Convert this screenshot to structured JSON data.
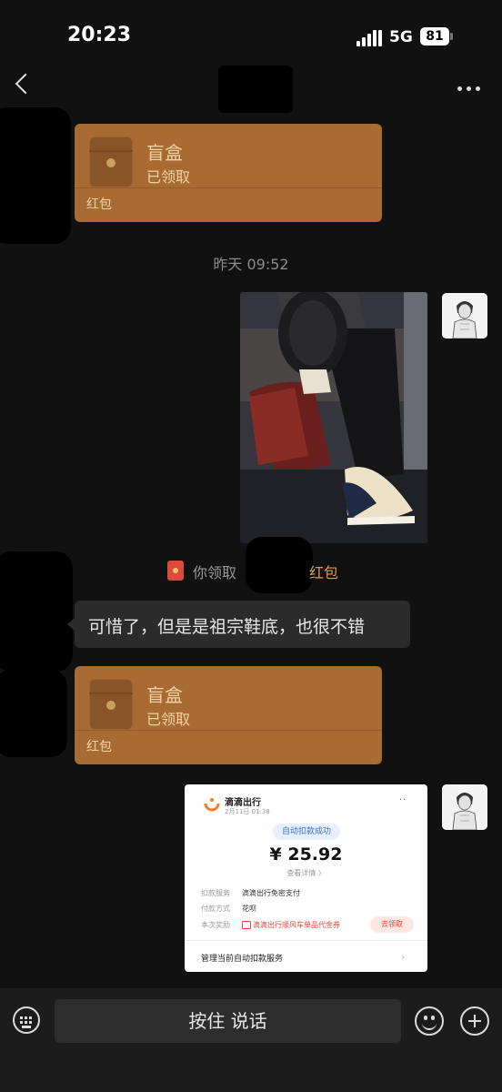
{
  "status_bar": {
    "time": "20:23",
    "network": "5G",
    "battery": "81"
  },
  "nav": {
    "back_icon": "chevron-left-icon",
    "more_icon": "more-dots-icon"
  },
  "messages": {
    "packet_1": {
      "title": "盲盒",
      "status": "已领取",
      "label": "红包"
    },
    "timestamp": "昨天 09:52",
    "notice": {
      "text": "你领取",
      "link": "红包"
    },
    "text_bubble": "可惜了，但是是祖宗鞋底，也很不错",
    "packet_2": {
      "title": "盲盒",
      "status": "已领取",
      "label": "红包"
    }
  },
  "payment_card": {
    "app_name": "滴滴出行",
    "date": "2月11日 01:38",
    "badge": "自动扣款成功",
    "amount": "¥ 25.92",
    "detail_link": "查看详情 〉",
    "rows": [
      {
        "key": "扣款服务",
        "value": "滴滴出行免密支付"
      },
      {
        "key": "付款方式",
        "value": "花呗"
      },
      {
        "key": "本次奖励",
        "value": "滴滴出行顺风车单品代金券"
      }
    ],
    "claim": "去领取",
    "manage": "管理当前自动扣款服务",
    "brand_color": "#ff7a29"
  },
  "input_bar": {
    "voice_label": "按住 说话",
    "keyboard_icon": "keyboard-icon",
    "emoji_icon": "emoji-icon",
    "plus_icon": "plus-icon"
  },
  "colors": {
    "background": "#111111",
    "packet": "#a86c33",
    "bubble": "#2b2b2b",
    "link": "#d99a56"
  }
}
